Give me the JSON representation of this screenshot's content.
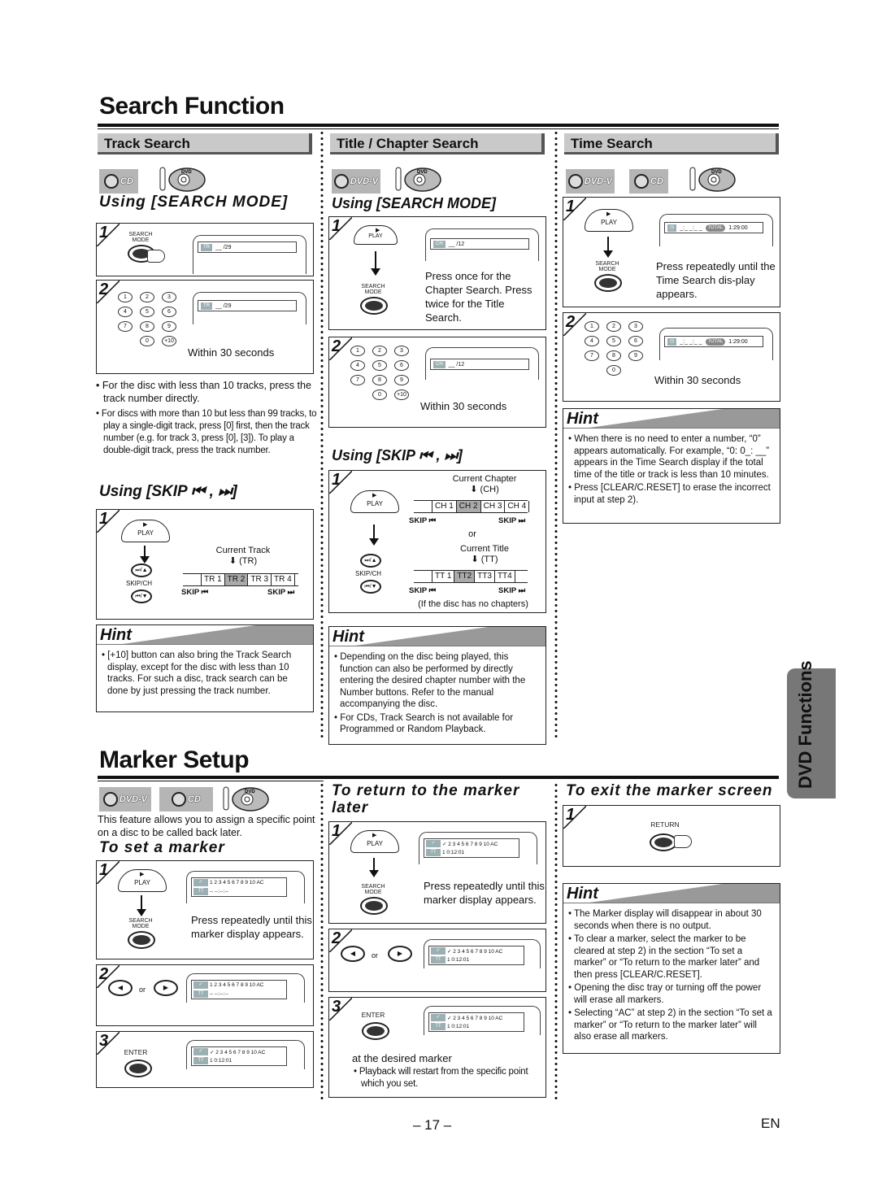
{
  "search_function": {
    "title": "Search Function",
    "track_search": {
      "header": "Track Search",
      "discs": [
        "CD",
        "DVD"
      ],
      "subhead_mode": "Using [SEARCH MODE]",
      "step1": {
        "num": "1",
        "button": "SEARCH MODE",
        "osd_tag": "TR",
        "osd_text": "__ /29"
      },
      "step2": {
        "num": "2",
        "keys": [
          "1",
          "2",
          "3",
          "4",
          "5",
          "6",
          "7",
          "8",
          "9",
          "0",
          "+10"
        ],
        "osd_tag": "TR",
        "osd_text": "__ /29",
        "caption": "Within 30 seconds"
      },
      "notes": [
        "For the disc with less than 10 tracks, press the track number directly."
      ],
      "notes_small": [
        "For discs with more than 10 but less than 99 tracks, to play a single-digit track, press [0] first, then the track number (e.g. for track 3, press [0], [3]). To play a double-digit track, press the track number."
      ],
      "subhead_skip": "Using [SKIP ⏮ , ⏭]",
      "skip_step": {
        "num": "1",
        "play": "PLAY",
        "skipch": "SKIP/CH",
        "current_label": "Current Track",
        "current_abbr": "(TR)",
        "cells": [
          "TR 1",
          "TR 2",
          "TR 3",
          "TR 4"
        ],
        "current_index": 1,
        "skip_back": "SKIP ⏮",
        "skip_fwd": "SKIP ⏭"
      },
      "hint": {
        "title": "Hint",
        "items": [
          "[+10] button can also bring the Track Search display, except for the disc with less than 10 tracks. For such a disc, track search can be done by just pressing the track number."
        ]
      }
    },
    "title_chapter_search": {
      "header": "Title / Chapter Search",
      "discs": [
        "DVD-V",
        "DVD"
      ],
      "subhead_mode": "Using [SEARCH MODE]",
      "step1": {
        "num": "1",
        "play": "PLAY",
        "button": "SEARCH MODE",
        "osd_tag": "CH",
        "osd_text": "__ /12",
        "caption": "Press once for the Chapter Search. Press twice for the Title Search."
      },
      "step2": {
        "num": "2",
        "keys": [
          "1",
          "2",
          "3",
          "4",
          "5",
          "6",
          "7",
          "8",
          "9",
          "0",
          "+10"
        ],
        "osd_tag": "CH",
        "osd_text": "__ /12",
        "caption": "Within 30 seconds"
      },
      "subhead_skip": "Using [SKIP ⏮ , ⏭]",
      "skip_step": {
        "num": "1",
        "play": "PLAY",
        "skipch": "SKIP/CH",
        "chapter_label": "Current Chapter",
        "chapter_abbr": "(CH)",
        "chapter_cells": [
          "CH 1",
          "CH 2",
          "CH 3",
          "CH 4"
        ],
        "chapter_current_index": 1,
        "or": "or",
        "title_label": "Current Title",
        "title_abbr": "(TT)",
        "title_cells": [
          "TT 1",
          "TT2",
          "TT3",
          "TT4"
        ],
        "title_current_index": 1,
        "skip_back": "SKIP ⏮",
        "skip_fwd": "SKIP ⏭",
        "footnote": "(If the disc has no chapters)"
      },
      "hint": {
        "title": "Hint",
        "items": [
          "Depending on the disc being played, this function can also be performed by directly entering the desired chapter number with the Number buttons. Refer to the manual accompanying the disc.",
          "For CDs, Track Search is not available for Programmed or Random Playback."
        ]
      }
    },
    "time_search": {
      "header": "Time Search",
      "discs": [
        "DVD-V",
        "CD",
        "DVD"
      ],
      "step1": {
        "num": "1",
        "play": "PLAY",
        "button": "SEARCH MODE",
        "osd_time": "_:_ _:_ _",
        "osd_total_label": "TOTAL",
        "osd_total": "1:29:00",
        "caption": "Press repeatedly until the Time Search dis-play appears."
      },
      "step2": {
        "num": "2",
        "keys": [
          "1",
          "2",
          "3",
          "4",
          "5",
          "6",
          "7",
          "8",
          "9",
          "0"
        ],
        "osd_time": "_:_ _:_ _",
        "osd_total_label": "TOTAL",
        "osd_total": "1:29:00",
        "caption": "Within 30 seconds"
      },
      "hint": {
        "title": "Hint",
        "items": [
          "When there is no need to enter a number, “0” appears automatically. For example, “0: 0_: __” appears in the Time Search display if the total time of the title or track is less than 10 minutes.",
          "Press [CLEAR/C.RESET] to erase the incorrect input at step 2)."
        ]
      }
    }
  },
  "marker_setup": {
    "title": "Marker Setup",
    "discs": [
      "DVD-V",
      "CD",
      "DVD"
    ],
    "intro": "This feature allows you to assign a specific point on a disc to be called back later.",
    "set_marker": {
      "subhead": "To set a marker",
      "step1": {
        "num": "1",
        "play": "PLAY",
        "button": "SEARCH MODE",
        "caption": "Press repeatedly until this marker display appears.",
        "markers": "1 2 3 4 5 6 7 8 9 10 AC",
        "tt_value": "-- --:--:--"
      },
      "step2": {
        "num": "2",
        "or": "or",
        "markers": "1 2 3 4 5 6 7 8 9 10 AC",
        "tt_value": "-- --:--:--"
      },
      "step3": {
        "num": "3",
        "button": "ENTER",
        "markers": "✓ 2 3 4 5 6 7 8 9 10 AC",
        "tt_value": "1  0:12:01"
      }
    },
    "return_marker": {
      "subhead": "To return to the marker later",
      "step1": {
        "num": "1",
        "play": "PLAY",
        "button": "SEARCH MODE",
        "caption": "Press repeatedly until this marker display appears.",
        "tt_value": "1  0:12:01"
      },
      "step2": {
        "num": "2",
        "or": "or",
        "tt_value": "1  0:12:01"
      },
      "step3": {
        "num": "3",
        "button": "ENTER",
        "tt_value": "1  0:12:01",
        "caption": "at the desired marker",
        "note": "Playback will restart from the specific point which you set."
      }
    },
    "exit_marker": {
      "subhead": "To exit the marker screen",
      "step1": {
        "num": "1",
        "button": "RETURN"
      }
    },
    "hint": {
      "title": "Hint",
      "items": [
        "The Marker display will disappear in about 30 seconds when there is no output.",
        "To clear a marker, select the marker to be cleared at step 2) in the section “To set a marker” or “To return to the marker later” and then press [CLEAR/C.RESET].",
        "Opening the disc tray or turning off the power will erase all markers.",
        "Selecting “AC” at step 2) in the section “To set a marker” or “To return to the marker later” will also erase all markers."
      ]
    }
  },
  "side_tab": "DVD Functions",
  "footer": {
    "page": "– 17 –",
    "lang": "EN"
  },
  "osd_tags": {
    "check": "✓",
    "tt": "TT"
  }
}
